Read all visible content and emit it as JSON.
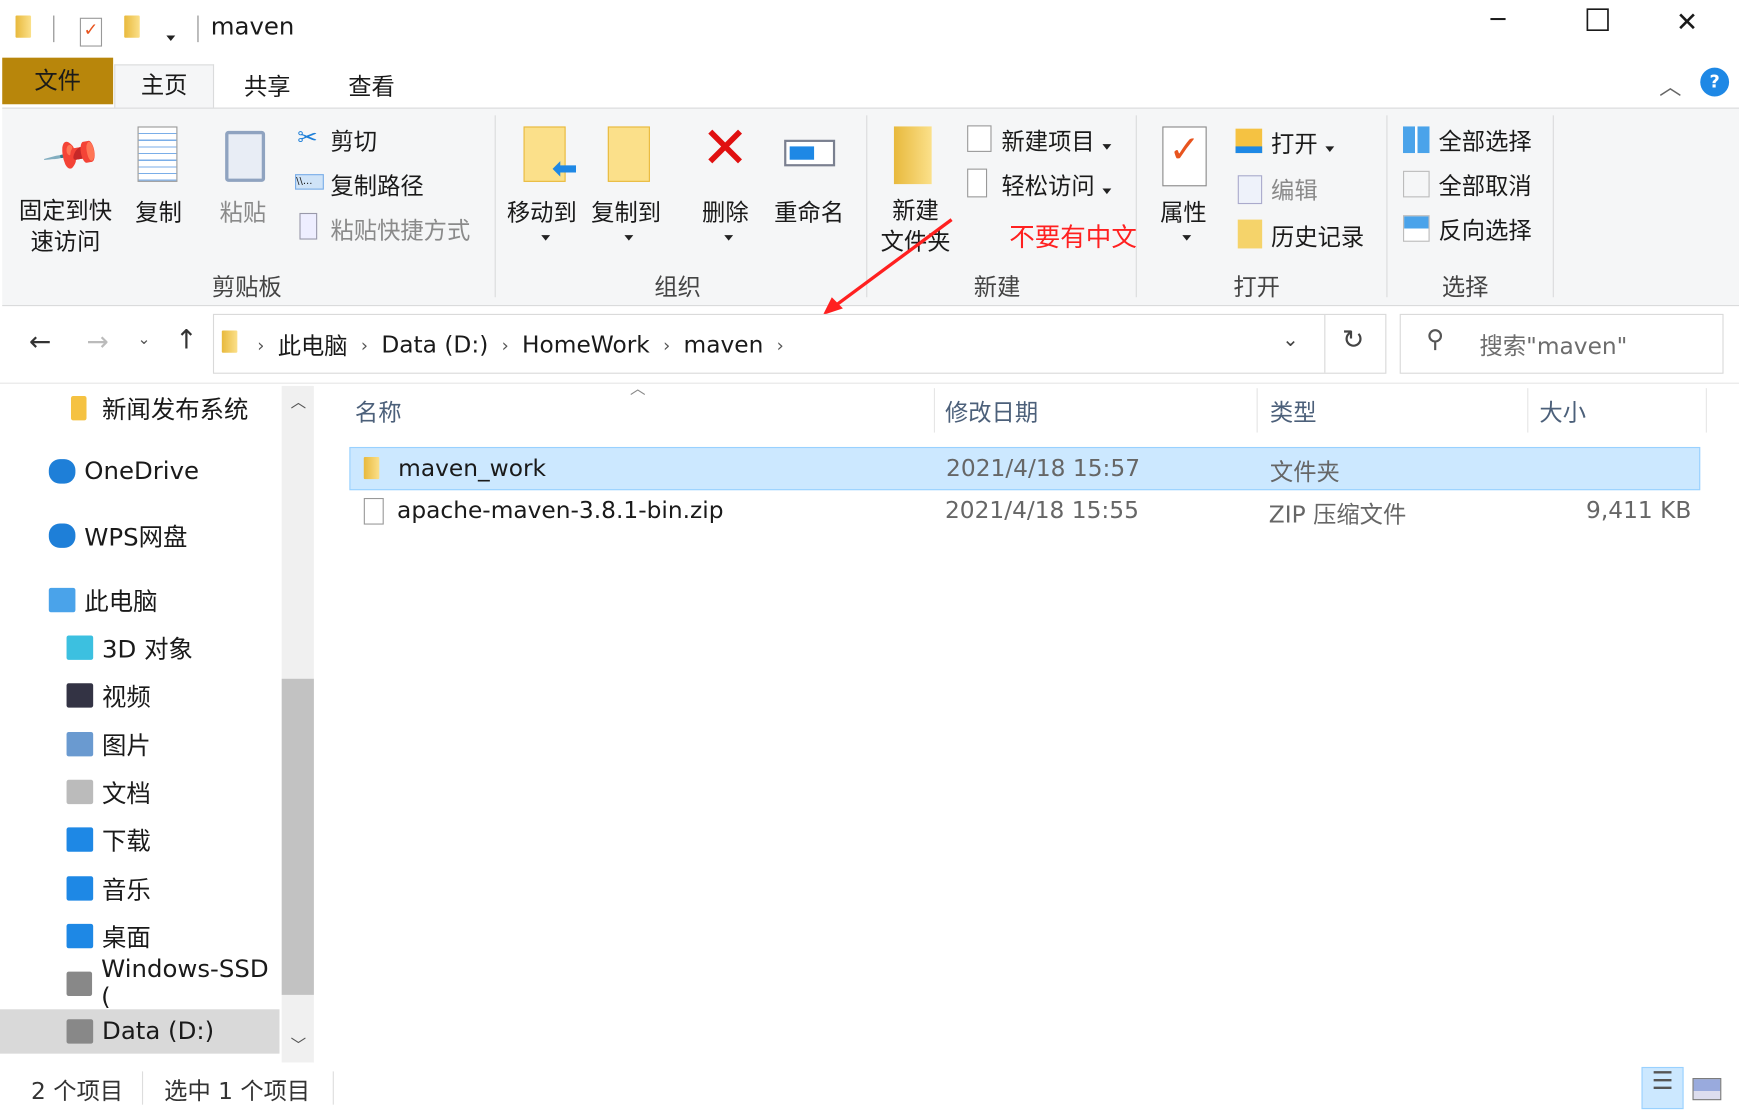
{
  "window": {
    "title": "maven",
    "minimize": "─",
    "maximize": "☐",
    "close": "✕"
  },
  "tabs": [
    {
      "label": "文件",
      "active": false
    },
    {
      "label": "主页",
      "active": true
    },
    {
      "label": "共享"
    },
    {
      "label": "查看"
    }
  ],
  "help": "?",
  "ribbon": {
    "clipboard": {
      "group": "剪贴板",
      "pin": "固定到快\n速访问",
      "pin1": "固定到快",
      "pin2": "速访问",
      "copy": "复制",
      "paste": "粘贴",
      "cut": "剪切",
      "copy_path": "复制路径",
      "paste_shortcut": "粘贴快捷方式"
    },
    "organize": {
      "group": "组织",
      "move_to": "移动到",
      "copy_to": "复制到",
      "delete": "删除",
      "rename": "重命名"
    },
    "new": {
      "group": "新建",
      "new_folder1": "新建",
      "new_folder2": "文件夹",
      "new_item": "新建项目",
      "easy_access": "轻松访问"
    },
    "open": {
      "group": "打开",
      "properties": "属性",
      "open": "打开",
      "edit": "编辑",
      "history": "历史记录"
    },
    "select": {
      "group": "选择",
      "select_all": "全部选择",
      "select_none": "全部取消",
      "invert": "反向选择"
    }
  },
  "annotation": {
    "text": "不要有中文",
    "color": "#ff2020"
  },
  "address": {
    "crumbs": [
      "此电脑",
      "Data (D:)",
      "HomeWork",
      "maven"
    ],
    "search_placeholder": "搜索\"maven\""
  },
  "nav": {
    "items": [
      "新闻发布系统",
      "OneDrive",
      "WPS网盘",
      "此电脑",
      "3D 对象",
      "视频",
      "图片",
      "文档",
      "下载",
      "音乐",
      "桌面",
      "Windows-SSD (",
      "Data (D:)"
    ],
    "selected": "Data (D:)"
  },
  "columns": {
    "name": "名称",
    "date": "修改日期",
    "type": "类型",
    "size": "大小"
  },
  "files": [
    {
      "name": "maven_work",
      "date": "2021/4/18 15:57",
      "type": "文件夹",
      "size": "",
      "selected": true
    },
    {
      "name": "apache-maven-3.8.1-bin.zip",
      "date": "2021/4/18 15:55",
      "type": "ZIP 压缩文件",
      "size": "9,411 KB",
      "selected": false
    }
  ],
  "status": {
    "count": "2 个项目",
    "selected": "选中 1 个项目"
  },
  "colors": {
    "file_tab": "#b8860b",
    "selection": "#cce8ff",
    "accent": "#0078d7"
  }
}
